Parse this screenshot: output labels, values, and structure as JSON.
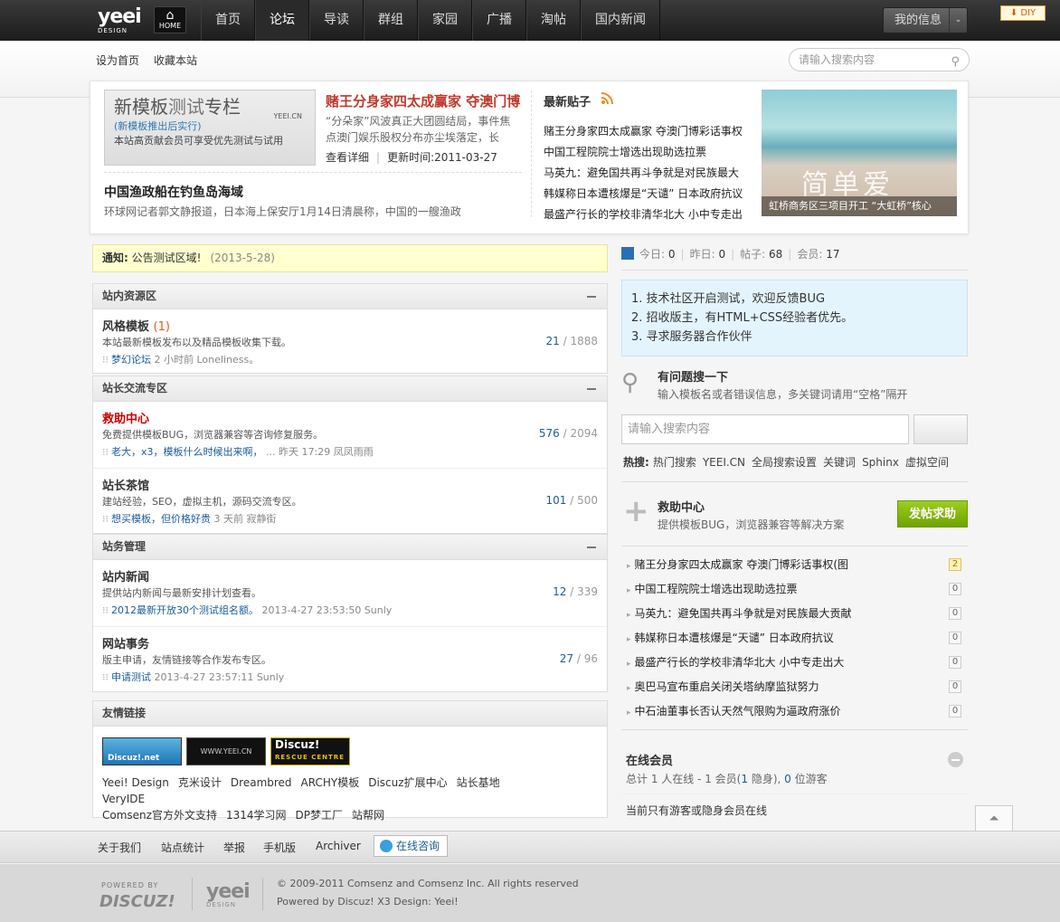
{
  "topnav": {
    "logo": "yeei",
    "logo_sub": "DESIGN",
    "home_label": "HOME",
    "items": [
      "首页",
      "论坛",
      "导读",
      "群组",
      "家园",
      "广播",
      "淘帖",
      "国内新闻"
    ],
    "active_index": 1,
    "myinfo_label": "我的信息",
    "diy_label": "DIY"
  },
  "subbar": {
    "set_home": "设为首页",
    "bookmark": "收藏本站",
    "search_placeholder": "请输入搜索内容"
  },
  "promo": {
    "title_a": "新模板",
    "title_b": "测试",
    "title_c": "专栏",
    "brand": "YEEI.CN",
    "subtitle": "(新模板推出后实行)",
    "desc": "本站高贡献会员可享受优先测试与试用"
  },
  "headline": {
    "title": "赌王分身家四太成赢家 夺澳门博",
    "desc": "“分朵家”风波真正大团圆结局，事件焦点澳门娱乐股权分布亦尘埃落定，长",
    "detail_link": "查看详细",
    "update": "更新时间:2011-03-27"
  },
  "news2": {
    "title": "中国渔政船在钓鱼岛海域",
    "desc": "环球网记者郭文静报道，日本海上保安厅1月14日清晨称，中国的一艘渔政"
  },
  "latest": {
    "title": "最新贴子",
    "items": [
      "赌王分身家四太成赢家 夺澳门博彩话事权",
      "中国工程院院士增选出现助选拉票",
      "马英九：避免国共再斗争就是对民族最大",
      "韩媒称日本遭核爆是“天谴” 日本政府抗议",
      "最盛产行长的学校非清华北大 小中专走出"
    ]
  },
  "image": {
    "big_text": "简单爱",
    "caption": "虹桥商务区三项目开工 “大虹桥”核心"
  },
  "notice": {
    "label": "通知:",
    "text": "公告测试区域!",
    "date": "(2013-5-28)"
  },
  "section1": {
    "title": "站内资源区",
    "forums": [
      {
        "name": "风格模板",
        "count": "(1)",
        "desc": "本站最新模板发布以及精品模板收集下载。",
        "last_link": "梦幻论坛",
        "last_meta": "2 小时前 Loneliness。",
        "threads": "21",
        "posts": "1888"
      }
    ]
  },
  "section2": {
    "title": "站长交流专区",
    "forums": [
      {
        "name": "救助中心",
        "desc": "免费提供模板BUG，浏览器兼容等咨询修复服务。",
        "last_link": "老大，x3，模板什么时候出来啊，",
        "last_meta": "... 昨天 17:29 凤凤雨雨",
        "threads": "576",
        "posts": "2094"
      },
      {
        "name": "站长茶馆",
        "desc": "建站经验，SEO，虚拟主机，源码交流专区。",
        "last_link": "想买模板，但价格好贵",
        "last_meta": "3 天前 寂静街",
        "threads": "101",
        "posts": "500"
      }
    ]
  },
  "section3": {
    "title": "站务管理",
    "forums": [
      {
        "name": "站内新闻",
        "desc": "提供站内新闻与最新安排计划查看。",
        "last_link": "2012最新开放30个测试组名额。",
        "last_meta": "2013-4-27 23:53:50 Sunly",
        "threads": "12",
        "posts": "339"
      },
      {
        "name": "网站事务",
        "desc": "版主申请，友情链接等合作发布专区。",
        "last_link": "申请测试",
        "last_meta": "2013-4-27 23:57:11 Sunly",
        "threads": "27",
        "posts": "96"
      }
    ]
  },
  "links": {
    "title": "友情链接",
    "badge1": "Discuz!.net",
    "badge2": "WWW.YEEI.CN",
    "badge3": "Discuz!",
    "badge3_sub": "RESCUE CENTRE",
    "words": [
      "Yeei! Design",
      "克米设计",
      "Dreambred",
      "ARCHY模板",
      "Discuz扩展中心",
      "站长基地",
      "VeryIDE",
      "Comsenz官方外文支持",
      "1314学习网",
      "DP梦工厂",
      "站帮网"
    ]
  },
  "stats": {
    "today_label": "今日:",
    "today": "0",
    "yesterday_label": "昨日:",
    "yesterday": "0",
    "posts_label": "帖子:",
    "posts": "68",
    "members_label": "会员:",
    "members": "17"
  },
  "bluebox": {
    "lines": [
      "1. 技术社区开启测试，欢迎反馈BUG",
      "2. 招收版主，有HTML+CSS经验者优先。",
      "3. 寻求服务器合作伙伴"
    ]
  },
  "qsearch": {
    "title": "有问题搜一下",
    "desc": "输入模板名或者错误信息，多关键词请用“空格”隔开",
    "placeholder": "请输入搜索内容",
    "hot_label": "热搜:",
    "hot": [
      "热门搜索",
      "YEEI.CN",
      "全局搜索设置",
      "关键词",
      "Sphinx",
      "虚拟空间"
    ]
  },
  "help": {
    "title": "救助中心",
    "desc": "提供模板BUG，浏览器兼容等解决方案",
    "button": "发帖求助"
  },
  "threads": [
    {
      "title": "赌王分身家四太成赢家 夺澳门博彩话事权(图",
      "n": "2"
    },
    {
      "title": "中国工程院院士增选出现助选拉票",
      "n": "0"
    },
    {
      "title": "马英九：避免国共再斗争就是对民族最大贡献",
      "n": "0"
    },
    {
      "title": "韩媒称日本遭核爆是“天谴” 日本政府抗议",
      "n": "0"
    },
    {
      "title": "最盛产行长的学校非清华北大 小中专走出大",
      "n": "0"
    },
    {
      "title": "奥巴马宣布重启关闭关塔纳摩监狱努力",
      "n": "0"
    },
    {
      "title": "中石油董事长否认天然气限购为逼政府涨价",
      "n": "0"
    }
  ],
  "online": {
    "title": "在线会员",
    "sum_a": "总计 1 人在线 - 1 会员(",
    "sum_b": "1",
    "sum_c": " 隐身), ",
    "sum_d": "0",
    "sum_e": " 位游客",
    "none": "当前只有游客或隐身会员在线"
  },
  "footer": {
    "nav": [
      "关于我们",
      "站点统计",
      "举报",
      "手机版",
      "Archiver"
    ],
    "consult": "在线咨询",
    "powered_by_label": "POWERED BY",
    "discuz": "DISCUZ!",
    "logo": "yeei",
    "logo_sub": "DESIGN",
    "copyright": "© 2009-2011 Comsenz   and Comsenz Inc.  All rights reserved",
    "powered": "Powered by Discuz!  X3 Design: Yeei!"
  }
}
